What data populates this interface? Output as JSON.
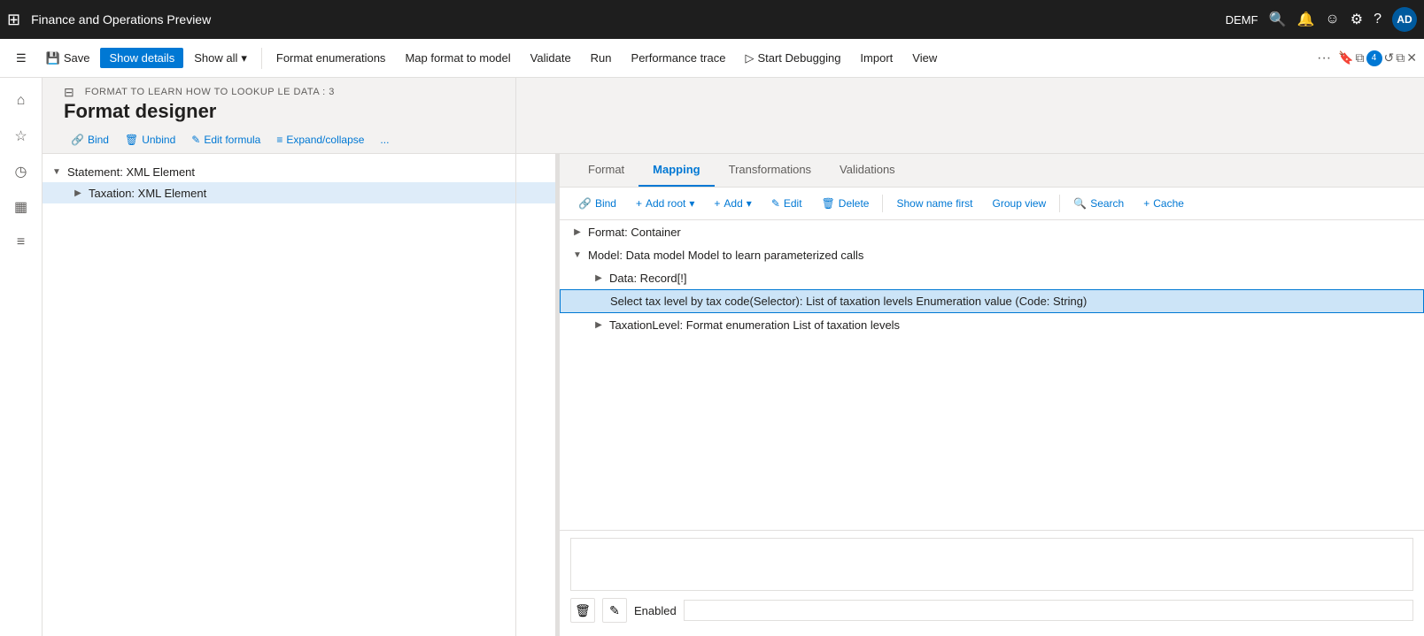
{
  "app": {
    "title": "Finance and Operations Preview",
    "user": "DEMF",
    "avatar_initials": "AD"
  },
  "commandbar": {
    "save_label": "Save",
    "show_details_label": "Show details",
    "show_all_label": "Show all",
    "format_enumerations_label": "Format enumerations",
    "map_format_label": "Map format to model",
    "validate_label": "Validate",
    "run_label": "Run",
    "performance_trace_label": "Performance trace",
    "start_debugging_label": "Start Debugging",
    "import_label": "Import",
    "view_label": "View"
  },
  "page": {
    "subtitle": "FORMAT TO LEARN HOW TO LOOKUP LE DATA : 3",
    "title": "Format designer"
  },
  "format_toolbar": {
    "bind_label": "Bind",
    "unbind_label": "Unbind",
    "edit_formula_label": "Edit formula",
    "expand_collapse_label": "Expand/collapse",
    "more_label": "..."
  },
  "left_tree": {
    "items": [
      {
        "label": "Statement: XML Element",
        "level": 0,
        "expanded": true,
        "toggle": "▼"
      },
      {
        "label": "Taxation: XML Element",
        "level": 1,
        "expanded": false,
        "toggle": "▶",
        "selected": true
      }
    ]
  },
  "tabs": [
    {
      "label": "Format",
      "active": false
    },
    {
      "label": "Mapping",
      "active": true
    },
    {
      "label": "Transformations",
      "active": false
    },
    {
      "label": "Validations",
      "active": false
    }
  ],
  "mapping_toolbar": {
    "bind_label": "Bind",
    "add_root_label": "Add root",
    "add_label": "Add",
    "edit_label": "Edit",
    "delete_label": "Delete",
    "show_name_first_label": "Show name first",
    "group_view_label": "Group view",
    "search_label": "Search",
    "cache_label": "Cache"
  },
  "mapping_tree": {
    "items": [
      {
        "label": "Format: Container",
        "level": 0,
        "expanded": false,
        "toggle": "▶"
      },
      {
        "label": "Model: Data model Model to learn parameterized calls",
        "level": 0,
        "expanded": true,
        "toggle": "▼"
      },
      {
        "label": "Data: Record[!]",
        "level": 1,
        "expanded": false,
        "toggle": "▶"
      },
      {
        "label": "Select tax level by tax code(Selector): List of taxation levels Enumeration value (Code: String)",
        "level": 2,
        "expanded": false,
        "toggle": "",
        "selected": true
      },
      {
        "label": "TaxationLevel: Format enumeration List of taxation levels",
        "level": 1,
        "expanded": false,
        "toggle": "▶"
      }
    ]
  },
  "bottom_panel": {
    "delete_icon": "🗑",
    "edit_icon": "✎",
    "enabled_label": "Enabled"
  },
  "icons": {
    "apps": "⊞",
    "hamburger": "☰",
    "home": "⌂",
    "star": "☆",
    "clock": "◷",
    "calendar": "▦",
    "list": "≡",
    "filter": "⊟",
    "search": "🔍",
    "bell": "🔔",
    "smiley": "☺",
    "gear": "⚙",
    "help": "?",
    "link": "🔗",
    "pencil": "✎",
    "trash": "🗑",
    "expand_collapse": "≡",
    "refresh": "↺",
    "restore": "⧉",
    "close": "✕"
  }
}
